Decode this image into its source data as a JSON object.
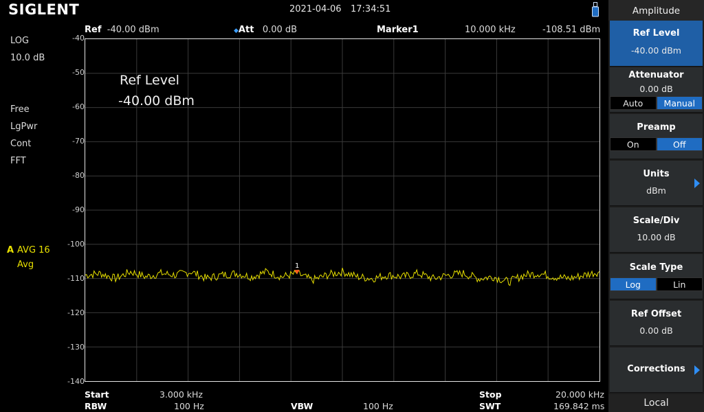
{
  "header": {
    "logo": "SIGLENT",
    "date": "2021-04-06",
    "time": "17:34:51"
  },
  "info_bar": {
    "ref_label": "Ref",
    "ref_value": "-40.00 dBm",
    "att_label": "Att",
    "att_value": "0.00 dB",
    "marker_label": "Marker1",
    "marker_freq": "10.000 kHz",
    "marker_level": "-108.51 dBm"
  },
  "left_status": {
    "scale_type": "LOG",
    "scale_div": "10.0 dB",
    "trig": "Free",
    "detector": "LgPwr",
    "sweep": "Cont",
    "mode": "FFT",
    "trace_letter": "A",
    "trace_avg": "AVG 16",
    "trace_mode": "Avg"
  },
  "annotation": {
    "title": "Ref Level",
    "value": "-40.00 dBm"
  },
  "y_ticks": [
    "-40",
    "-50",
    "-60",
    "-70",
    "-80",
    "-90",
    "-100",
    "-110",
    "-120",
    "-130",
    "-140"
  ],
  "bottom_bar": {
    "start_label": "Start",
    "start_value": "3.000 kHz",
    "stop_label": "Stop",
    "stop_value": "20.000 kHz",
    "rbw_label": "RBW",
    "rbw_value": "100 Hz",
    "vbw_label": "VBW",
    "vbw_value": "100 Hz",
    "swt_label": "SWT",
    "swt_value": "169.842 ms"
  },
  "menu": {
    "title": "Amplitude",
    "ref_level": {
      "label": "Ref Level",
      "value": "-40.00 dBm"
    },
    "attenuator": {
      "label": "Attenuator",
      "value": "0.00 dB",
      "opt_a": "Auto",
      "opt_b": "Manual"
    },
    "preamp": {
      "label": "Preamp",
      "opt_a": "On",
      "opt_b": "Off"
    },
    "units": {
      "label": "Units",
      "value": "dBm"
    },
    "scale_div": {
      "label": "Scale/Div",
      "value": "10.00 dB"
    },
    "scale_type": {
      "label": "Scale Type",
      "opt_a": "Log",
      "opt_b": "Lin"
    },
    "ref_offset": {
      "label": "Ref Offset",
      "value": "0.00 dB"
    },
    "corrections": {
      "label": "Corrections"
    },
    "local": "Local"
  },
  "marker": {
    "label": "1",
    "freq_khz": 10.0,
    "level_dbm": -108.51
  },
  "chart_data": {
    "type": "line",
    "x_unit": "kHz",
    "y_unit": "dBm",
    "xlim": [
      3.0,
      20.0
    ],
    "ylim": [
      -140,
      -40
    ],
    "grid": true,
    "trace_color": "#e8e000",
    "series": [
      {
        "x": [
          3.0,
          3.5,
          4.0,
          4.5,
          5.0,
          5.5,
          6.0,
          6.5,
          7.0,
          7.5,
          8.0,
          8.5,
          9.0,
          9.5,
          10.0,
          10.5,
          11.0,
          11.5,
          12.0,
          12.5,
          13.0,
          13.5,
          14.0,
          14.5,
          15.0,
          15.5,
          16.0,
          16.5,
          17.0,
          17.5,
          18.0,
          18.5,
          19.0,
          19.5,
          20.0
        ],
        "y": [
          -109.0,
          -108.5,
          -110.0,
          -108.0,
          -109.5,
          -108.5,
          -109.0,
          -108.0,
          -110.0,
          -109.0,
          -108.5,
          -109.5,
          -108.0,
          -109.5,
          -108.5,
          -110.5,
          -109.0,
          -108.0,
          -109.5,
          -110.0,
          -109.0,
          -109.5,
          -108.5,
          -110.0,
          -109.0,
          -108.5,
          -110.0,
          -109.5,
          -111.0,
          -109.0,
          -108.5,
          -109.5,
          -110.0,
          -109.0,
          -108.0
        ]
      }
    ]
  }
}
